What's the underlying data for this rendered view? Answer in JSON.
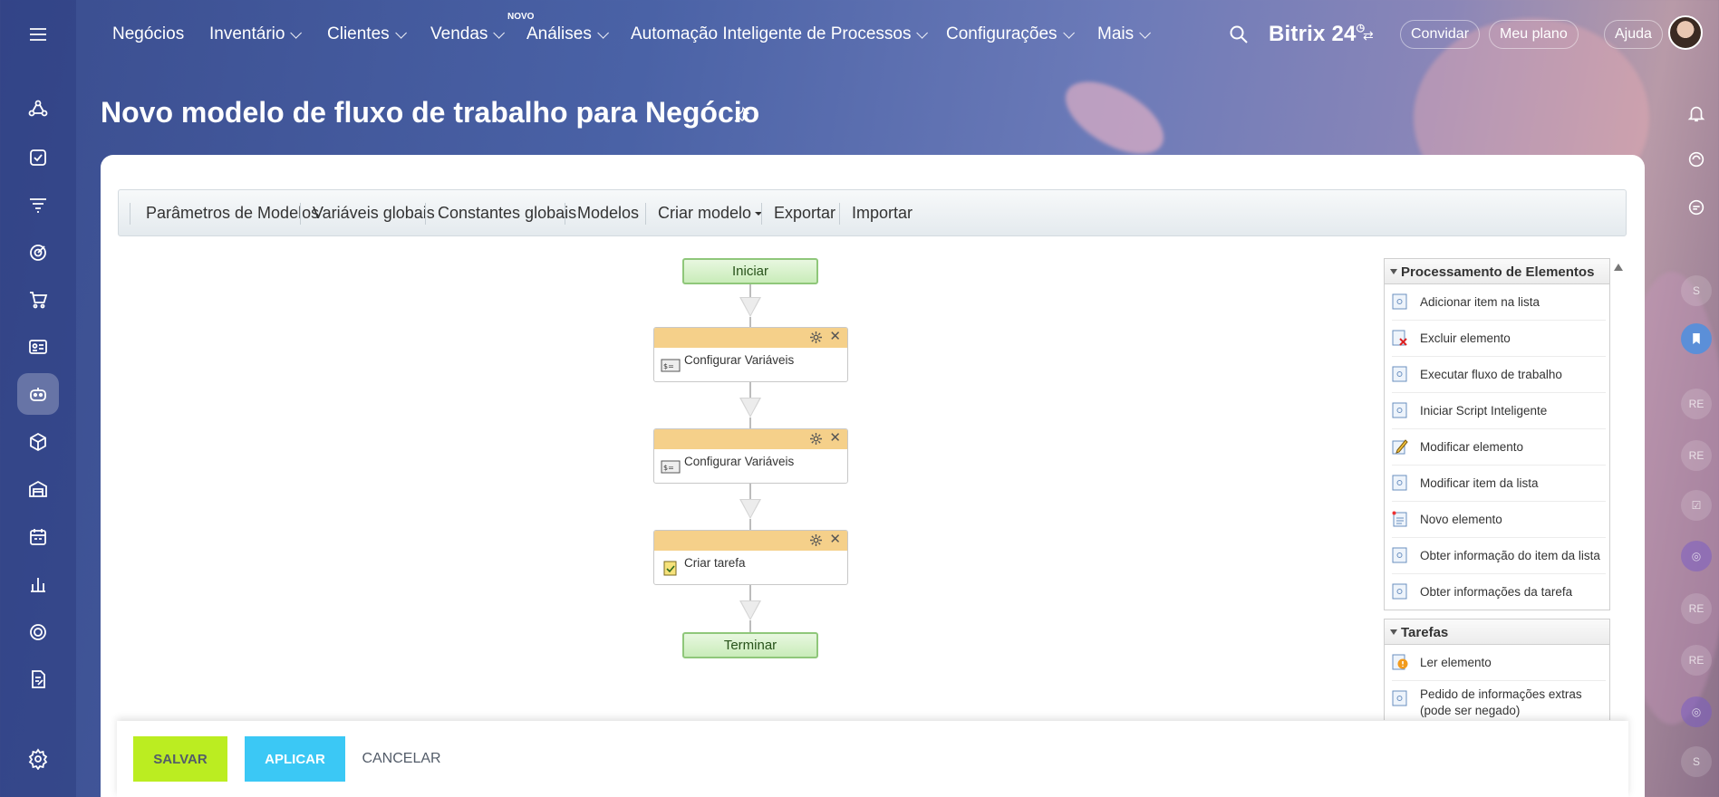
{
  "topbar": {
    "nav": [
      {
        "label": "Negócios",
        "chevron": false
      },
      {
        "label": "Inventário",
        "chevron": true
      },
      {
        "label": "Clientes",
        "chevron": true
      },
      {
        "label": "Vendas",
        "chevron": true
      },
      {
        "label": "Análises",
        "chevron": true
      },
      {
        "label": "Automação Inteligente de Processos",
        "chevron": true
      },
      {
        "label": "Configurações",
        "chevron": true
      },
      {
        "label": "Mais",
        "chevron": true
      }
    ],
    "new_badge": "NOVO",
    "brand": "Bitrix",
    "brand_suffix": "24",
    "invite": "Convidar",
    "plan": "Meu plano",
    "help": "Ajuda"
  },
  "page": {
    "title": "Novo modelo de fluxo de trabalho para Negócio"
  },
  "toolbar": {
    "items": [
      "Parâmetros de Modelos",
      "Variáveis globais",
      "Constantes globais",
      "Modelos",
      "Criar modelo",
      "Exportar",
      "Importar"
    ]
  },
  "workflow": {
    "start": "Iniciar",
    "end": "Terminar",
    "activities": [
      {
        "label": "Configurar Variáveis",
        "icon": "variables-icon"
      },
      {
        "label": "Configurar Variáveis",
        "icon": "variables-icon"
      },
      {
        "label": "Criar tarefa",
        "icon": "task-icon"
      }
    ]
  },
  "panel": {
    "groups": [
      {
        "title": "Processamento de Elementos",
        "items": [
          {
            "label": "Adicionar item na lista",
            "icon": "list-icon"
          },
          {
            "label": "Excluir elemento",
            "icon": "delete-doc-icon"
          },
          {
            "label": "Executar fluxo de trabalho",
            "icon": "list-icon"
          },
          {
            "label": "Iniciar Script Inteligente",
            "icon": "list-icon"
          },
          {
            "label": "Modificar elemento",
            "icon": "edit-icon"
          },
          {
            "label": "Modificar item da lista",
            "icon": "list-icon"
          },
          {
            "label": "Novo elemento",
            "icon": "new-doc-icon"
          },
          {
            "label": "Obter informação do item da lista",
            "icon": "list-icon"
          },
          {
            "label": "Obter informações da tarefa",
            "icon": "list-icon"
          }
        ]
      },
      {
        "title": "Tarefas",
        "items": [
          {
            "label": "Ler elemento",
            "icon": "warning-doc-icon"
          },
          {
            "label": "Pedido de informações extras (pode ser negado)",
            "icon": "list-icon"
          }
        ]
      }
    ]
  },
  "footer": {
    "save": "SALVAR",
    "apply": "APLICAR",
    "cancel": "CANCELAR"
  },
  "rail": [
    "S",
    "RE",
    "RE",
    "RE",
    "RE",
    "S"
  ],
  "colors": {
    "save": "#bbed21",
    "apply": "#3bc8f5",
    "activity_header": "#f5d08a",
    "start_node": "#c9ecb9"
  }
}
